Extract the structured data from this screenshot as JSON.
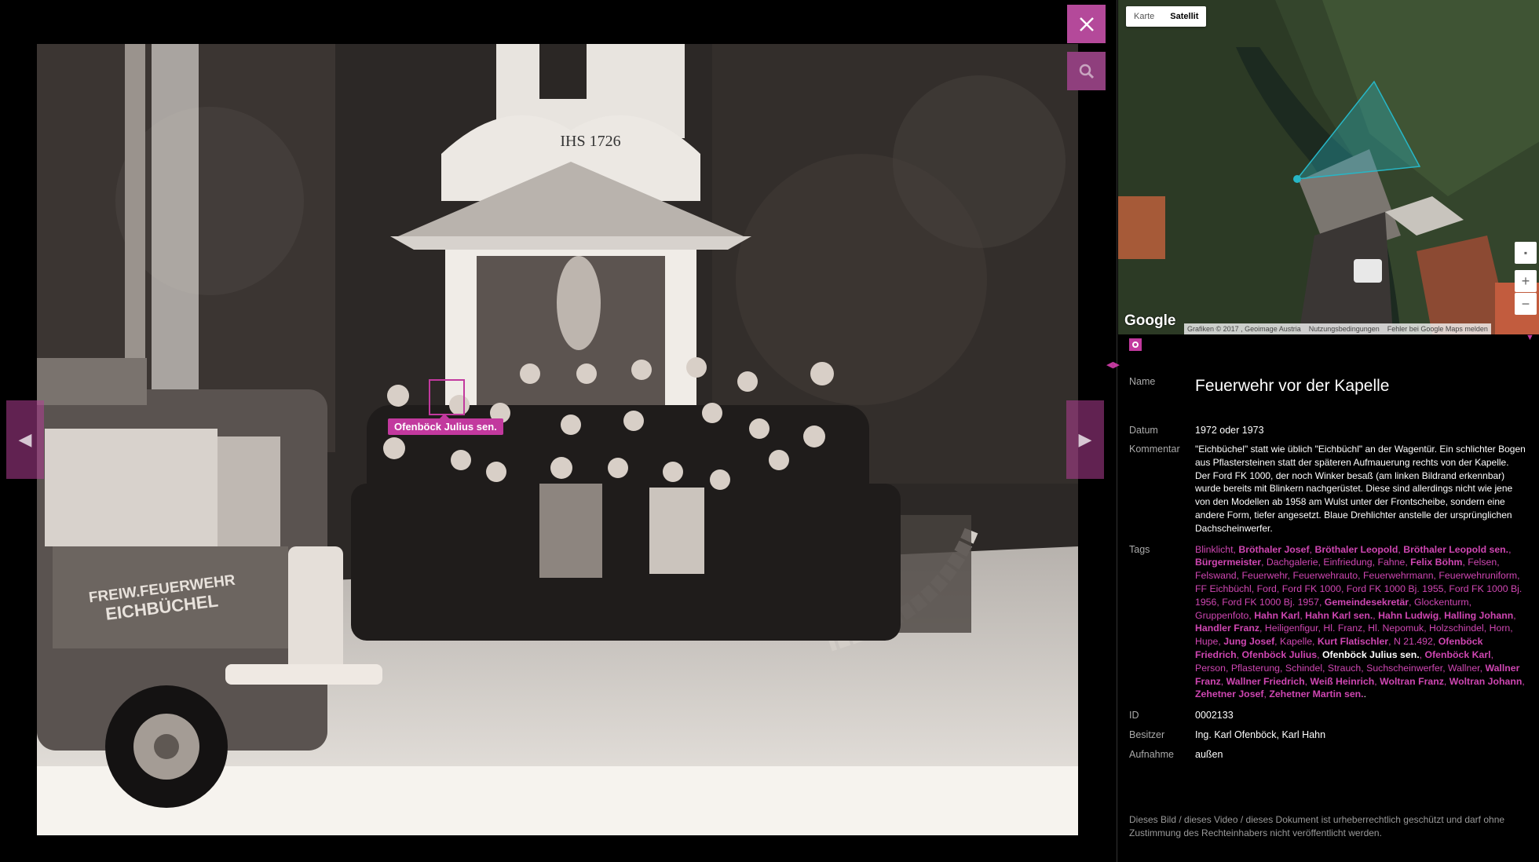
{
  "viewer": {
    "prev_arrow": "◀",
    "next_arrow": "▶",
    "face_tag_label": "Ofenböck Julius sen.",
    "photo_texts": {
      "chapel_inscription": "IHS 1726",
      "truck_lettering_1": "FREIW.FEUERWEHR",
      "truck_lettering_2": "EICHBÜCHEL"
    }
  },
  "map": {
    "type_buttons": [
      "Karte",
      "Satellit"
    ],
    "active_type": "Satellit",
    "logo": "Google",
    "attribution": [
      "Grafiken © 2017 , Geoimage Austria",
      "Nutzungsbedingungen",
      "Fehler bei Google Maps melden"
    ],
    "zoom_in": "+",
    "zoom_out": "−"
  },
  "details": {
    "name_label": "Name",
    "name": "Feuerwehr vor der Kapelle",
    "date_label": "Datum",
    "date": "1972 oder 1973",
    "comment_label": "Kommentar",
    "comment": "\"Eichbüchel\" statt wie üblich \"Eichbüchl\" an der Wagentür. Ein schlichter Bogen aus Pflastersteinen statt der späteren Aufmauerung rechts von der Kapelle. Der Ford FK 1000, der noch Winker besaß (am linken Bildrand erkennbar) wurde bereits mit Blinkern nachgerüstet. Diese sind allerdings nicht wie jene von den Modellen ab 1958 am Wulst unter der Frontscheibe, sondern eine andere Form, tiefer angesetzt. Blaue Drehlichter anstelle der ursprünglichen Dachscheinwerfer.",
    "tags_label": "Tags",
    "tags": [
      {
        "t": "Blinklicht",
        "s": "n"
      },
      {
        "t": "Bröthaler Josef",
        "s": "b"
      },
      {
        "t": "Bröthaler Leopold",
        "s": "b"
      },
      {
        "t": "Bröthaler Leopold sen.",
        "s": "b"
      },
      {
        "t": "Bürgermeister",
        "s": "b"
      },
      {
        "t": "Dachgalerie",
        "s": "n"
      },
      {
        "t": "Einfriedung",
        "s": "n"
      },
      {
        "t": "Fahne",
        "s": "n"
      },
      {
        "t": "Felix Böhm",
        "s": "b"
      },
      {
        "t": "Felsen",
        "s": "n"
      },
      {
        "t": "Felswand",
        "s": "n"
      },
      {
        "t": "Feuerwehr",
        "s": "n"
      },
      {
        "t": "Feuerwehrauto",
        "s": "n"
      },
      {
        "t": "Feuerwehrmann",
        "s": "n"
      },
      {
        "t": "Feuerwehruniform",
        "s": "n"
      },
      {
        "t": "FF Eichbüchl",
        "s": "n"
      },
      {
        "t": "Ford",
        "s": "n"
      },
      {
        "t": "Ford FK 1000",
        "s": "n"
      },
      {
        "t": "Ford FK 1000 Bj. 1955",
        "s": "n"
      },
      {
        "t": "Ford FK 1000 Bj. 1956",
        "s": "n"
      },
      {
        "t": "Ford FK 1000 Bj. 1957",
        "s": "n"
      },
      {
        "t": "Gemeindesekretär",
        "s": "b"
      },
      {
        "t": "Glockenturm",
        "s": "n"
      },
      {
        "t": "Gruppenfoto",
        "s": "n"
      },
      {
        "t": "Hahn Karl",
        "s": "b"
      },
      {
        "t": "Hahn Karl sen.",
        "s": "b"
      },
      {
        "t": "Hahn Ludwig",
        "s": "b"
      },
      {
        "t": "Halling Johann",
        "s": "b"
      },
      {
        "t": "Handler Franz",
        "s": "b"
      },
      {
        "t": "Heiligenfigur",
        "s": "n"
      },
      {
        "t": "Hl. Franz",
        "s": "n"
      },
      {
        "t": "Hl. Nepomuk",
        "s": "n"
      },
      {
        "t": "Holzschindel",
        "s": "n"
      },
      {
        "t": "Horn",
        "s": "n"
      },
      {
        "t": "Hupe",
        "s": "n"
      },
      {
        "t": "Jung Josef",
        "s": "b"
      },
      {
        "t": "Kapelle",
        "s": "n"
      },
      {
        "t": "Kurt Flatischler",
        "s": "b"
      },
      {
        "t": "N 21.492",
        "s": "n"
      },
      {
        "t": "Ofenböck Friedrich",
        "s": "b"
      },
      {
        "t": "Ofenböck Julius",
        "s": "b"
      },
      {
        "t": "Ofenböck Julius sen.",
        "s": "c"
      },
      {
        "t": "Ofenböck Karl",
        "s": "b"
      },
      {
        "t": "Person",
        "s": "n"
      },
      {
        "t": "Pflasterung",
        "s": "n"
      },
      {
        "t": "Schindel",
        "s": "n"
      },
      {
        "t": "Strauch",
        "s": "n"
      },
      {
        "t": "Suchscheinwerfer",
        "s": "n"
      },
      {
        "t": "Wallner",
        "s": "n"
      },
      {
        "t": "Wallner Franz",
        "s": "b"
      },
      {
        "t": "Wallner Friedrich",
        "s": "b"
      },
      {
        "t": "Weiß Heinrich",
        "s": "b"
      },
      {
        "t": "Woltran Franz",
        "s": "b"
      },
      {
        "t": "Woltran Johann",
        "s": "b"
      },
      {
        "t": "Zehetner Josef",
        "s": "b"
      },
      {
        "t": "Zehetner Martin sen.",
        "s": "b"
      }
    ],
    "id_label": "ID",
    "id": "0002133",
    "owner_label": "Besitzer",
    "owner": "Ing. Karl Ofenböck, Karl Hahn",
    "shot_label": "Aufnahme",
    "shot": "außen",
    "copyright": "Dieses Bild / dieses Video / dieses Dokument ist urheberrechtlich geschützt und darf ohne Zustimmung des Rechteinhabers nicht veröffentlicht werden."
  },
  "colors": {
    "accent": "#c2399e",
    "button": "#b4499a",
    "map_cone": "#27b6c6"
  },
  "icons": [
    "close-icon",
    "magnifier-icon",
    "prev-arrow-icon",
    "next-arrow-icon",
    "camera-icon",
    "fullscreen-icon"
  ]
}
